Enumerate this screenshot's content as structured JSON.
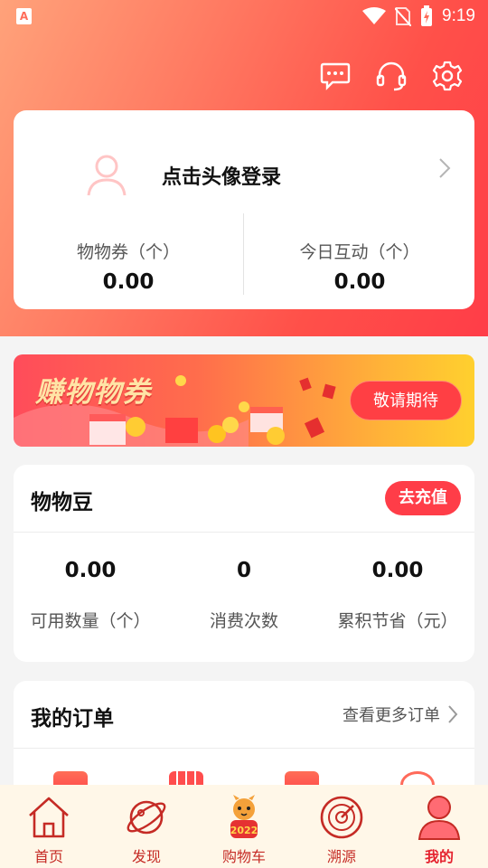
{
  "status_bar": {
    "time": "9:19",
    "app_badge": "A"
  },
  "top_actions": {
    "message_icon": "message-icon",
    "support_icon": "headset-icon",
    "settings_icon": "gear-icon"
  },
  "profile": {
    "login_prompt": "点击头像登录",
    "stats": [
      {
        "label": "物物券（个）",
        "value": "0.00"
      },
      {
        "label": "今日互动（个）",
        "value": "0.00"
      }
    ]
  },
  "banner": {
    "title": "赚物物券",
    "button_label": "敬请期待"
  },
  "beans": {
    "title": "物物豆",
    "recharge_label": "去充值",
    "stats": [
      {
        "value": "0.00",
        "label": "可用数量（个）"
      },
      {
        "value": "0",
        "label": "消费次数"
      },
      {
        "value": "0.00",
        "label": "累积节省（元）"
      }
    ]
  },
  "orders": {
    "title": "我的订单",
    "more_label": "查看更多订单"
  },
  "nav": {
    "items": [
      {
        "label": "首页",
        "icon": "home-icon"
      },
      {
        "label": "发现",
        "icon": "planet-icon"
      },
      {
        "label": "购物车",
        "icon": "tiger-2022-icon"
      },
      {
        "label": "溯源",
        "icon": "radar-icon"
      },
      {
        "label": "我的",
        "icon": "user-icon"
      }
    ],
    "active_index": 4
  },
  "colors": {
    "accent": "#ff3d48",
    "nav_text": "#c52b25",
    "nav_bg": "#fff7e8"
  }
}
